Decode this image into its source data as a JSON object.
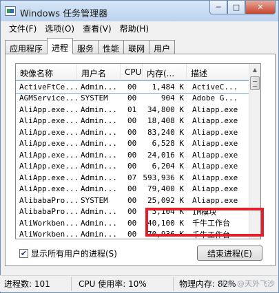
{
  "window": {
    "title": "Windows 任务管理器",
    "caption": {
      "minimize": "─",
      "maximize": "□",
      "close": "✕"
    }
  },
  "menu": [
    "文件(F)",
    "选项(O)",
    "查看(V)",
    "帮助(H)"
  ],
  "tabs": [
    "应用程序",
    "进程",
    "服务",
    "性能",
    "联网",
    "用户"
  ],
  "active_tab": "进程",
  "columns": [
    "映像名称",
    "用户名",
    "CPU",
    "内存(...",
    "描述"
  ],
  "processes": [
    {
      "name": "ActiveFtCe...",
      "user": "Admin...",
      "cpu": "00",
      "mem": "1,484 K",
      "desc": "ActiveC..."
    },
    {
      "name": "AGMService...",
      "user": "SYSTEM",
      "cpu": "00",
      "mem": "904 K",
      "desc": "Adobe G..."
    },
    {
      "name": "AliApp.exe...",
      "user": "Admin...",
      "cpu": "01",
      "mem": "34,800 K",
      "desc": "Aliapp.exe"
    },
    {
      "name": "AliApp.exe...",
      "user": "Admin...",
      "cpu": "00",
      "mem": "18,408 K",
      "desc": "Aliapp.exe"
    },
    {
      "name": "AliApp.exe...",
      "user": "Admin...",
      "cpu": "00",
      "mem": "83,240 K",
      "desc": "Aliapp.exe"
    },
    {
      "name": "AliApp.exe...",
      "user": "Admin...",
      "cpu": "00",
      "mem": "6,528 K",
      "desc": "Aliapp.exe"
    },
    {
      "name": "AliApp.exe...",
      "user": "Admin...",
      "cpu": "00",
      "mem": "24,016 K",
      "desc": "Aliapp.exe"
    },
    {
      "name": "AliApp.exe...",
      "user": "Admin...",
      "cpu": "00",
      "mem": "6,204 K",
      "desc": "Aliapp.exe"
    },
    {
      "name": "AliApp.exe...",
      "user": "Admin...",
      "cpu": "07",
      "mem": "593,936 K",
      "desc": "Aliapp.exe"
    },
    {
      "name": "AliApp.exe...",
      "user": "Admin...",
      "cpu": "00",
      "mem": "79,400 K",
      "desc": "Aliapp.exe"
    },
    {
      "name": "AlibabaPro...",
      "user": "SYSTEM",
      "cpu": "00",
      "mem": "25,092 K",
      "desc": "Aliapp.exe"
    },
    {
      "name": "AlibabaPro...",
      "user": "Admin...",
      "cpu": "00",
      "mem": "3,104 K",
      "desc": "IM模块"
    },
    {
      "name": "AliWorkben...",
      "user": "Admin...",
      "cpu": "00",
      "mem": "40,100 K",
      "desc": "千牛工作台"
    },
    {
      "name": "AliWorkben...",
      "user": "Admin...",
      "cpu": "00",
      "mem": "70,936 K",
      "desc": "千牛工作台"
    }
  ],
  "show_all_users_label": "显示所有用户的进程(S)",
  "show_all_users_checked": true,
  "end_process_label": "结束进程(E)",
  "status": {
    "process_count": "进程数: 101",
    "cpu_usage": "CPU 使用率: 10%",
    "physical_memory": "物理内存: 82%"
  },
  "watermark": "头条 @天外飞沙",
  "highlight_color": "#e0202a"
}
